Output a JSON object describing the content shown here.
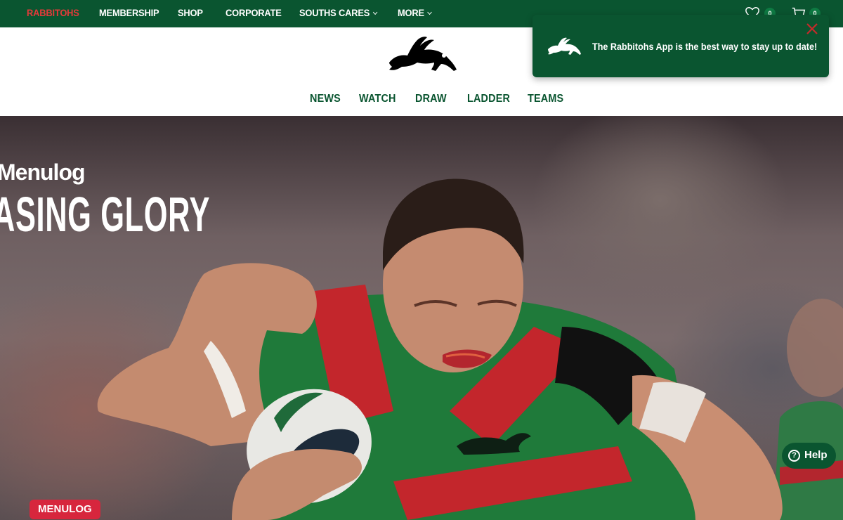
{
  "top_nav": {
    "items": [
      {
        "label": "RABBITOHS",
        "active": true
      },
      {
        "label": "MEMBERSHIP"
      },
      {
        "label": "SHOP"
      },
      {
        "label": "CORPORATE"
      },
      {
        "label": "SOUTHS CARES",
        "has_dropdown": true
      },
      {
        "label": "MORE",
        "has_dropdown": true
      }
    ],
    "wishlist": {
      "icon": "heart-icon",
      "count": "0"
    },
    "cart": {
      "icon": "cart-icon",
      "count": "0"
    }
  },
  "header": {
    "logo": "rabbitohs-rabbit-logo",
    "main_nav": [
      "NEWS",
      "WATCH",
      "DRAW",
      "LADDER",
      "TEAMS"
    ]
  },
  "hero": {
    "sponsor": "Menulog",
    "title": "ASING GLORY",
    "tag": "MENULOG"
  },
  "toast": {
    "icon": "rabbit-logo-icon",
    "message": "The Rabbitohs App is the best way to stay up to date!",
    "close_icon": "close-icon"
  },
  "help": {
    "label": "Help",
    "icon": "question-circle-icon"
  },
  "colors": {
    "brand_green": "#0a5530",
    "active_red": "#e53a3a",
    "tag_red": "#d7263d"
  }
}
